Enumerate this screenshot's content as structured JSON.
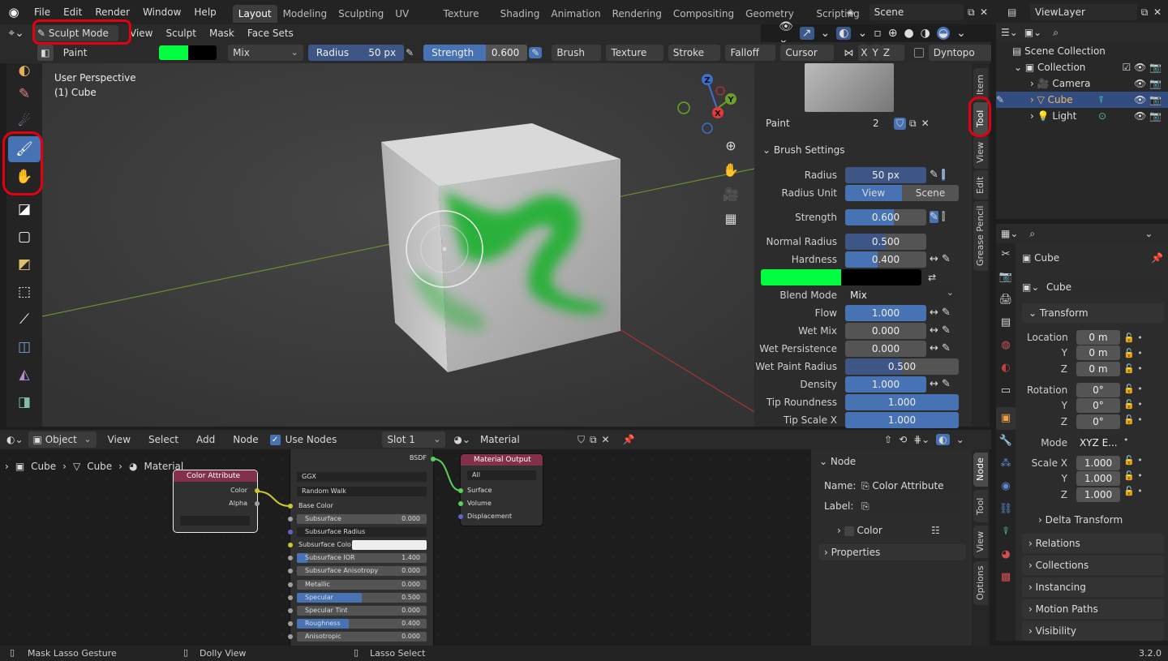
{
  "menu": {
    "items": [
      "File",
      "Edit",
      "Render",
      "Window",
      "Help"
    ]
  },
  "workspaces": {
    "tabs": [
      "Layout",
      "Modeling",
      "Sculpting",
      "UV Editing",
      "Texture Paint",
      "Shading",
      "Animation",
      "Rendering",
      "Compositing",
      "Geometry Nodes",
      "Scripting"
    ],
    "active": "Layout"
  },
  "scene": {
    "name": "Scene",
    "view_layer": "ViewLayer"
  },
  "viewport_header": {
    "mode": "Sculpt Mode",
    "menus": [
      "View",
      "Sculpt",
      "Mask",
      "Face Sets"
    ]
  },
  "tool_header": {
    "brush_name": "Paint",
    "blend": "Mix",
    "radius_label": "Radius",
    "radius_value": "50 px",
    "strength_label": "Strength",
    "strength_value": "0.600",
    "strength_fraction": 0.6,
    "menus": [
      "Brush",
      "Texture",
      "Stroke",
      "Falloff",
      "Cursor"
    ],
    "axes": [
      "X",
      "Y",
      "Z"
    ],
    "dyntopo": "Dyntopo"
  },
  "viewport": {
    "perspective": "User Perspective",
    "object": "(1) Cube"
  },
  "gizmo": {
    "z": "Z",
    "y": "Y",
    "x": "X"
  },
  "npanel": {
    "brush_name": "Paint",
    "brush_users": "2",
    "section": "Brush Settings",
    "radius": {
      "label": "Radius",
      "value": "50 px"
    },
    "radius_unit": {
      "label": "Radius Unit",
      "view": "View",
      "scene": "Scene"
    },
    "strength": {
      "label": "Strength",
      "value": "0.600",
      "fraction": 0.6
    },
    "normal_radius": {
      "label": "Normal Radius",
      "value": "0.500",
      "fraction": 0.5
    },
    "hardness": {
      "label": "Hardness",
      "value": "0.400",
      "fraction": 0.4
    },
    "blend_mode": {
      "label": "Blend Mode",
      "value": "Mix"
    },
    "flow": {
      "label": "Flow",
      "value": "1.000",
      "fraction": 1.0
    },
    "wet_mix": {
      "label": "Wet Mix",
      "value": "0.000",
      "fraction": 0.0
    },
    "wet_persistence": {
      "label": "Wet Persistence",
      "value": "0.000",
      "fraction": 0.0
    },
    "wet_paint_radius": {
      "label": "Wet Paint Radius",
      "value": "0.500",
      "fraction": 0.5
    },
    "density": {
      "label": "Density",
      "value": "1.000",
      "fraction": 1.0
    },
    "tip_roundness": {
      "label": "Tip Roundness",
      "value": "1.000",
      "fraction": 1.0
    },
    "tip_scale_x": {
      "label": "Tip Scale X",
      "value": "1.000",
      "fraction": 1.0
    },
    "tabs": [
      "Item",
      "Tool",
      "View",
      "Edit",
      "Grease Pencil"
    ]
  },
  "outliner": {
    "root": "Scene Collection",
    "collection": "Collection",
    "items": [
      "Camera",
      "Cube",
      "Light"
    ]
  },
  "properties": {
    "object_name": "Cube",
    "datablock": "Cube",
    "transform": "Transform",
    "location_label": "Location",
    "rotation_label": "Rotation",
    "scale_label": "Scale X",
    "axis_y": "Y",
    "axis_z": "Z",
    "loc": [
      "0 m",
      "0 m",
      "0 m"
    ],
    "rot": [
      "0°",
      "0°",
      "0°"
    ],
    "mode_label": "Mode",
    "mode_value": "XYZ E...",
    "scale": [
      "1.000",
      "1.000",
      "1.000"
    ],
    "delta": "Delta Transform",
    "panels": [
      "Relations",
      "Collections",
      "Instancing",
      "Motion Paths",
      "Visibility"
    ]
  },
  "node_header": {
    "type": "Object",
    "menus": [
      "View",
      "Select",
      "Add",
      "Node"
    ],
    "use_nodes": "Use Nodes",
    "slot": "Slot 1",
    "material": "Material"
  },
  "breadcrumb": [
    "Cube",
    "Cube",
    "Material"
  ],
  "nodes": {
    "color_attr": {
      "title": "Color Attribute",
      "out1": "Color",
      "out2": "Alpha"
    },
    "bsdf": {
      "out": "BSDF",
      "dist": "GGX",
      "sss": "Random Walk",
      "base_color": "Base Color",
      "subsurface": {
        "label": "Subsurface",
        "value": "0.000"
      },
      "subsurface_radius": "Subsurface Radius",
      "subsurface_color": "Subsurface Colo",
      "subsurface_ior": {
        "label": "Subsurface IOR",
        "value": "1.400"
      },
      "subsurface_aniso": {
        "label": "Subsurface Anisotropy",
        "value": "0.000"
      },
      "metallic": {
        "label": "Metallic",
        "value": "0.000"
      },
      "specular": {
        "label": "Specular",
        "value": "0.500"
      },
      "specular_tint": {
        "label": "Specular Tint",
        "value": "0.000"
      },
      "roughness": {
        "label": "Roughness",
        "value": "0.400"
      },
      "anisotropic": {
        "label": "Anisotropic",
        "value": "0.000"
      }
    },
    "output": {
      "title": "Material Output",
      "target": "All",
      "in1": "Surface",
      "in2": "Volume",
      "in3": "Displacement"
    }
  },
  "node_side": {
    "section": "Node",
    "name_label": "Name:",
    "name_value": "Color Attribute",
    "label_label": "Label:",
    "color": "Color",
    "properties": "Properties",
    "tabs": [
      "Node",
      "Tool",
      "View",
      "Options"
    ]
  },
  "status": {
    "left": "Mask Lasso Gesture",
    "mid": "Dolly View",
    "right": "Lasso Select",
    "version": "3.2.0"
  },
  "colors": {
    "accent": "#4772b3",
    "paint": "#00ff40",
    "highlight": "#e4000f"
  }
}
